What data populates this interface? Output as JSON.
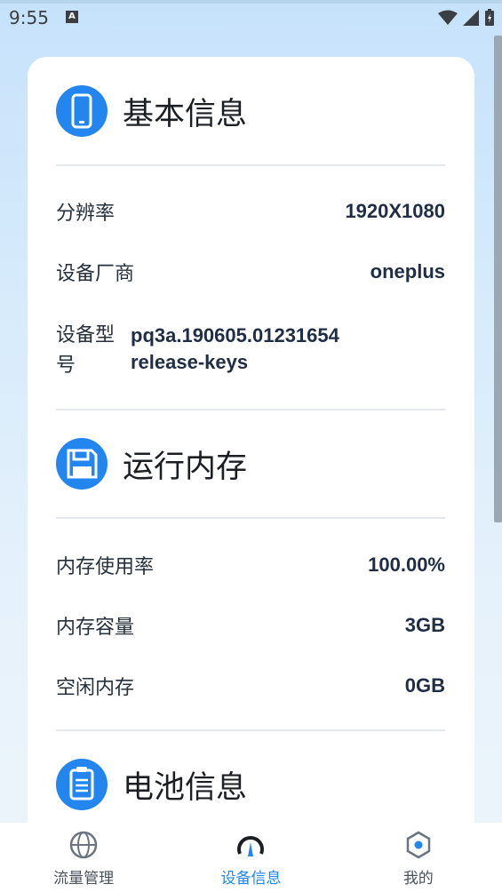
{
  "status_bar": {
    "time": "9:55",
    "notification_icon": "A"
  },
  "sections": [
    {
      "title": "基本信息",
      "icon": "phone-icon"
    },
    {
      "title": "运行内存",
      "icon": "memory-icon"
    },
    {
      "title": "电池信息",
      "icon": "clipboard-icon"
    }
  ],
  "basic_info": {
    "resolution": {
      "label": "分辨率",
      "value": "1920X1080"
    },
    "manufacturer": {
      "label": "设备厂商",
      "value": "oneplus"
    },
    "model": {
      "label": "设备型号",
      "value": "pq3a.190605.01231654 release-keys"
    }
  },
  "memory": {
    "usage": {
      "label": "内存使用率",
      "value": "100.00%"
    },
    "capacity": {
      "label": "内存容量",
      "value": "3GB"
    },
    "free": {
      "label": "空闲内存",
      "value": "0GB"
    }
  },
  "bottom_nav": [
    {
      "label": "流量管理",
      "icon": "globe-icon",
      "active": false
    },
    {
      "label": "设备信息",
      "icon": "gauge-icon",
      "active": true
    },
    {
      "label": "我的",
      "icon": "settings-icon",
      "active": false
    }
  ],
  "colors": {
    "accent": "#2386ef",
    "inactive": "#4a525c",
    "card": "#ffffff"
  }
}
